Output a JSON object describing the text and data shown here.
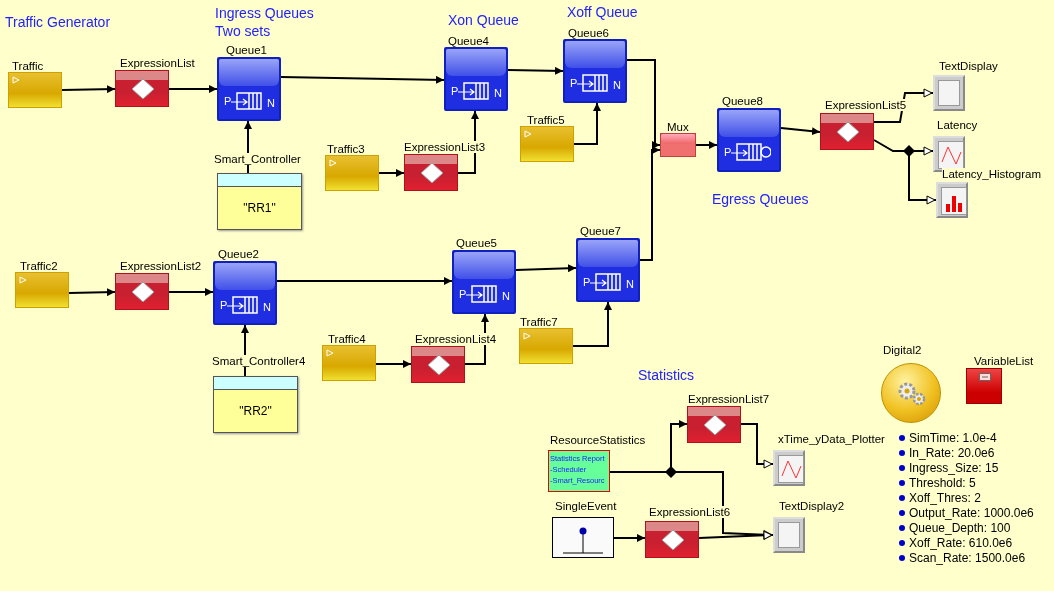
{
  "annotations": [
    "Traffic Generator",
    "Ingress Queues\nTwo sets",
    "Xon Queue",
    "Xoff Queue",
    "Egress Queues",
    "Statistics"
  ],
  "blocks": [
    {
      "kind": "source",
      "label": "Traffic"
    },
    {
      "kind": "expression",
      "label": "ExpressionList"
    },
    {
      "kind": "queue",
      "label": "Queue1",
      "p_label": "P",
      "n_label": "N"
    },
    {
      "kind": "controller",
      "label": "Smart_Controller",
      "value": "\"RR1\""
    },
    {
      "kind": "source",
      "label": "Traffic3"
    },
    {
      "kind": "queue",
      "label": "Queue4",
      "p_label": "P",
      "n_label": "N"
    },
    {
      "kind": "expression",
      "label": "ExpressionList3"
    },
    {
      "kind": "queue",
      "label": "Queue6",
      "p_label": "P",
      "n_label": "N"
    },
    {
      "kind": "source",
      "label": "Traffic5"
    },
    {
      "kind": "mux",
      "label": "Mux"
    },
    {
      "kind": "server_queue",
      "label": "Queue8",
      "p_label": "P"
    },
    {
      "kind": "expression",
      "label": "ExpressionList5"
    },
    {
      "kind": "display",
      "label": "TextDisplay"
    },
    {
      "kind": "plot",
      "label": "Latency"
    },
    {
      "kind": "histogram",
      "label": "Latency_Histogram"
    },
    {
      "kind": "source",
      "label": "Traffic2"
    },
    {
      "kind": "expression",
      "label": "ExpressionList2"
    },
    {
      "kind": "queue",
      "label": "Queue2",
      "p_label": "P",
      "n_label": "N"
    },
    {
      "kind": "controller",
      "label": "Smart_Controller4",
      "value": "\"RR2\""
    },
    {
      "kind": "source",
      "label": "Traffic4"
    },
    {
      "kind": "queue",
      "label": "Queue5",
      "p_label": "P",
      "n_label": "N"
    },
    {
      "kind": "expression",
      "label": "ExpressionList4"
    },
    {
      "kind": "queue",
      "label": "Queue7",
      "p_label": "P",
      "n_label": "N"
    },
    {
      "kind": "source",
      "label": "Traffic7"
    },
    {
      "kind": "digital",
      "label": "Digital2"
    },
    {
      "kind": "variable_list",
      "label": "VariableList"
    },
    {
      "kind": "expression",
      "label": "ExpressionList7"
    },
    {
      "kind": "statistics",
      "label": "ResourceStatistics",
      "lines": [
        "Statistics Report",
        "-Scheduler",
        "-Smart_Resourc"
      ]
    },
    {
      "kind": "plot",
      "label": "xTime_yData_Plotter"
    },
    {
      "kind": "event",
      "label": "SingleEvent"
    },
    {
      "kind": "expression",
      "label": "ExpressionList6"
    },
    {
      "kind": "display",
      "label": "TextDisplay2"
    }
  ],
  "parameters": [
    "SimTime: 1.0e-4",
    "In_Rate: 20.0e6",
    "Ingress_Size: 15",
    "Threshold: 5",
    "Xoff_Thres: 2",
    "Output_Rate: 1000.0e6",
    "Queue_Depth: 100",
    "Xoff_Rate: 610.0e6",
    "Scan_Rate: 1500.0e6"
  ]
}
